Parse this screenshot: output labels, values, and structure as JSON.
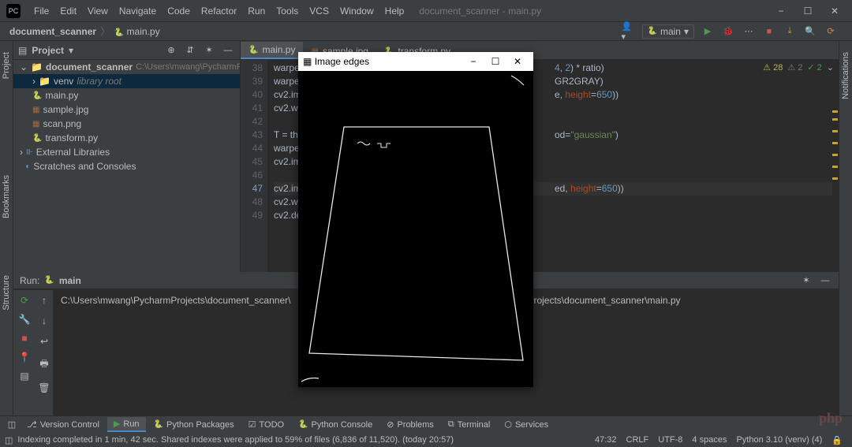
{
  "menu": {
    "items": [
      "File",
      "Edit",
      "View",
      "Navigate",
      "Code",
      "Refactor",
      "Run",
      "Tools",
      "VCS",
      "Window",
      "Help"
    ],
    "project_name": "document_scanner - main.py"
  },
  "breadcrumb": {
    "root": "document_scanner",
    "file": "main.py"
  },
  "run_config": {
    "name": "main"
  },
  "project_tool": {
    "title": "Project",
    "root": "document_scanner",
    "root_path": "C:\\Users\\mwang\\PycharmProjects",
    "venv": "venv",
    "venv_note": "library root",
    "files": [
      "main.py",
      "sample.jpg",
      "scan.png",
      "transform.py"
    ],
    "ext_libs": "External Libraries",
    "scratches": "Scratches and Consoles"
  },
  "editor": {
    "tabs": [
      "main.py",
      "sample.jpg",
      "transform.py"
    ],
    "active_tab": 0,
    "lines_start": 38,
    "lines": [
      "warped",
      "warped",
      "cv2.im",
      "cv2.wa",
      "",
      "T = th",
      "warped",
      "cv2.im",
      "",
      "cv2.im",
      "cv2.wa",
      "cv2.de"
    ],
    "tail": {
      "0": "4, 2) * ratio)",
      "1": "GR2GRAY)",
      "2": "e, height=650))",
      "5": "od=\"gaussian\")",
      "9": "ed, height=650))"
    },
    "warnings": "28",
    "weak_warnings": "2",
    "checks": "2"
  },
  "cv_window": {
    "title": "Image edges"
  },
  "run": {
    "title": "Run:",
    "config": "main",
    "output": "C:\\Users\\mwang\\PycharmProjects\\document_scanner\\",
    "output2": "Projects\\document_scanner\\main.py"
  },
  "bottom_tools": [
    "Version Control",
    "Run",
    "Python Packages",
    "TODO",
    "Python Console",
    "Problems",
    "Terminal",
    "Services"
  ],
  "status": {
    "msg": "Indexing completed in 1 min, 42 sec. Shared indexes were applied to 59% of files (6,836 of 11,520). (today 20:57)",
    "pos": "47:32",
    "lf": "CRLF",
    "enc": "UTF-8",
    "indent": "4 spaces",
    "py": "Python 3.10 (venv) (4)"
  }
}
